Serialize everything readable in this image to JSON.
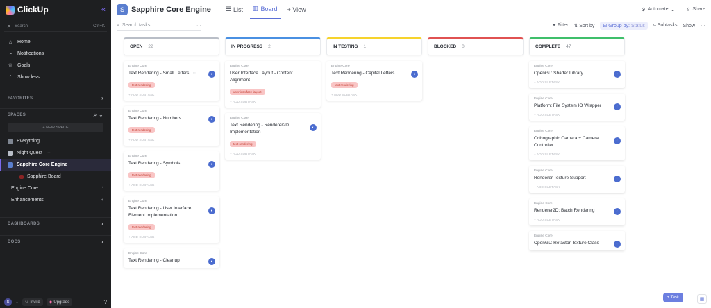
{
  "app": {
    "name": "ClickUp"
  },
  "sidebar": {
    "search": {
      "placeholder": "Search",
      "shortcut": "Ctrl+K"
    },
    "nav": [
      {
        "label": "Home",
        "icon": "home-icon"
      },
      {
        "label": "Notifications",
        "icon": "bell-icon"
      },
      {
        "label": "Goals",
        "icon": "trophy-icon"
      },
      {
        "label": "Show less",
        "icon": "chevron-up-icon"
      }
    ],
    "favorites": "FAVORITES",
    "spaces": "SPACES",
    "new_space": "+ NEW SPACE",
    "space_items": [
      {
        "label": "Everything"
      },
      {
        "label": "Night Quest"
      },
      {
        "label": "Sapphire Core Engine"
      },
      {
        "label": "Sapphire Board"
      },
      {
        "label": "Engine Core"
      },
      {
        "label": "Enhancements"
      }
    ],
    "dashboards": "DASHBOARDS",
    "docs": "DOCS",
    "bottom": {
      "avatar": "S",
      "invite": "Invite",
      "upgrade": "Upgrade"
    }
  },
  "header": {
    "title": "Sapphire Core Engine",
    "badge": "S",
    "tabs": [
      {
        "label": "List"
      },
      {
        "label": "Board"
      },
      {
        "label": "+ View"
      }
    ],
    "automate": "Automate",
    "share": "Share"
  },
  "toolbar": {
    "search_placeholder": "Search tasks...",
    "filter": "Filter",
    "sort": "Sort by",
    "group_label": "Group by:",
    "group_value": "Status",
    "subtasks": "Subtasks",
    "show": "Show"
  },
  "columns": [
    {
      "name": "OPEN",
      "count": "22",
      "color": "#b9bec7",
      "cards": [
        {
          "list": "Engine Core",
          "title": "Text Rendering - Small Letters",
          "tag": "text rendering",
          "add": "+ ADD SUBTASK",
          "avatar": true
        },
        {
          "list": "Engine Core",
          "title": "Text Rendering - Numbers",
          "tag": "text rendering",
          "add": "+ ADD SUBTASK",
          "avatar": true
        },
        {
          "list": "Engine Core",
          "title": "Text Rendering - Symbols",
          "tag": "text rendering",
          "add": "+ ADD SUBTASK",
          "avatar": true
        },
        {
          "list": "Engine Core",
          "title": "Text Rendering - User Interface Element Implementation",
          "tag": "text rendering",
          "add": "+ ADD SUBTASK",
          "avatar": true
        },
        {
          "list": "Engine Core",
          "title": "Text Rendering - Cleanup",
          "tag": "",
          "add": "",
          "avatar": true
        }
      ]
    },
    {
      "name": "IN PROGRESS",
      "count": "2",
      "color": "#4a90e2",
      "cards": [
        {
          "list": "Engine Core",
          "title": "User Interface Layout - Content Alignment",
          "tag": "user interface layout",
          "add": "+ ADD SUBTASK",
          "avatar": false
        },
        {
          "list": "Engine Core",
          "title": "Text Rendering - Renderer2D Implementation",
          "tag": "text rendering",
          "add": "+ ADD SUBTASK",
          "avatar": true
        }
      ]
    },
    {
      "name": "IN TESTING",
      "count": "1",
      "color": "#f6d32d",
      "cards": [
        {
          "list": "Engine Core",
          "title": "Text Rendering - Capital Letters",
          "tag": "text rendering",
          "add": "+ ADD SUBTASK",
          "avatar": true
        }
      ]
    },
    {
      "name": "BLOCKED",
      "count": "0",
      "color": "#e05252",
      "cards": []
    },
    {
      "name": "COMPLETE",
      "count": "47",
      "color": "#3fbf6b",
      "cards": [
        {
          "list": "Engine Core",
          "title": "OpenGL: Shader Library",
          "tag": "",
          "add": "+ ADD SUBTASK",
          "avatar": true
        },
        {
          "list": "Engine Core",
          "title": "Platform: File System IO Wrapper",
          "tag": "",
          "add": "+ ADD SUBTASK",
          "avatar": true
        },
        {
          "list": "Engine Core",
          "title": "Orthographic Camera + Camera Controller",
          "tag": "",
          "add": "+ ADD SUBTASK",
          "avatar": true
        },
        {
          "list": "Engine Core",
          "title": "Renderer Texture Support",
          "tag": "",
          "add": "+ ADD SUBTASK",
          "avatar": true
        },
        {
          "list": "Engine Core",
          "title": "Renderer2D: Batch Rendering",
          "tag": "",
          "add": "+ ADD SUBTASK",
          "avatar": true
        },
        {
          "list": "Engine Core",
          "title": "OpenGL: Refactor Texture Class",
          "tag": "",
          "add": "",
          "avatar": true
        }
      ]
    }
  ],
  "float": {
    "task": "+ Task"
  }
}
